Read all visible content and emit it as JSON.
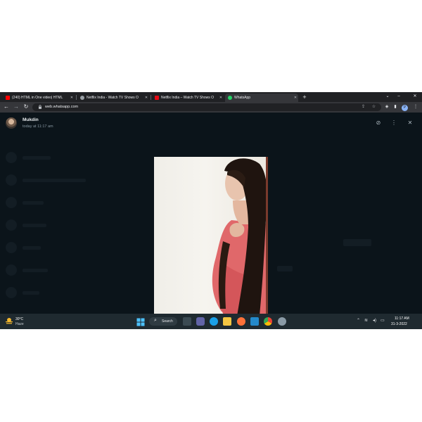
{
  "browser": {
    "tabs": [
      {
        "title": "(240) HTML in One video| HTML",
        "favicon": "youtube-icon",
        "color": "#ff0000"
      },
      {
        "title": "Netflix India - Watch TV Shows O",
        "favicon": "globe-icon",
        "color": "#9aa0a6"
      },
      {
        "title": "Netflix India – Watch TV Shows O",
        "favicon": "netflix-icon",
        "color": "#e50914"
      },
      {
        "title": "WhatsApp",
        "favicon": "whatsapp-icon",
        "color": "#25d366"
      }
    ],
    "new_tab": "+",
    "window_controls": {
      "minimize": "⌄",
      "maximize": "–",
      "close": "✕"
    },
    "url": "web.whatsapp.com",
    "profile_initial": "P"
  },
  "viewer": {
    "sender": "Mukdin",
    "timestamp": "today at 11:17 am",
    "photo_colors": {
      "skin": "#e8c4ae",
      "hair": "#1f140f",
      "top": "#e0686a",
      "background": "#f2f0eb"
    }
  },
  "taskbar": {
    "weather": {
      "temp": "30°C",
      "condition": "Haze"
    },
    "search_label": "Search",
    "apps": [
      "windows-start-icon",
      "file-explorer-icon",
      "teams-icon",
      "edge-icon",
      "folder-icon",
      "firefox-icon",
      "vscode-icon",
      "chrome-icon",
      "settings-icon"
    ],
    "clock": {
      "time": "11:17 AM",
      "date": "31-3-2022"
    }
  },
  "colors": {
    "accent": "#00a884",
    "panel": "#0b141a",
    "taskbar": "#1f2a30"
  }
}
